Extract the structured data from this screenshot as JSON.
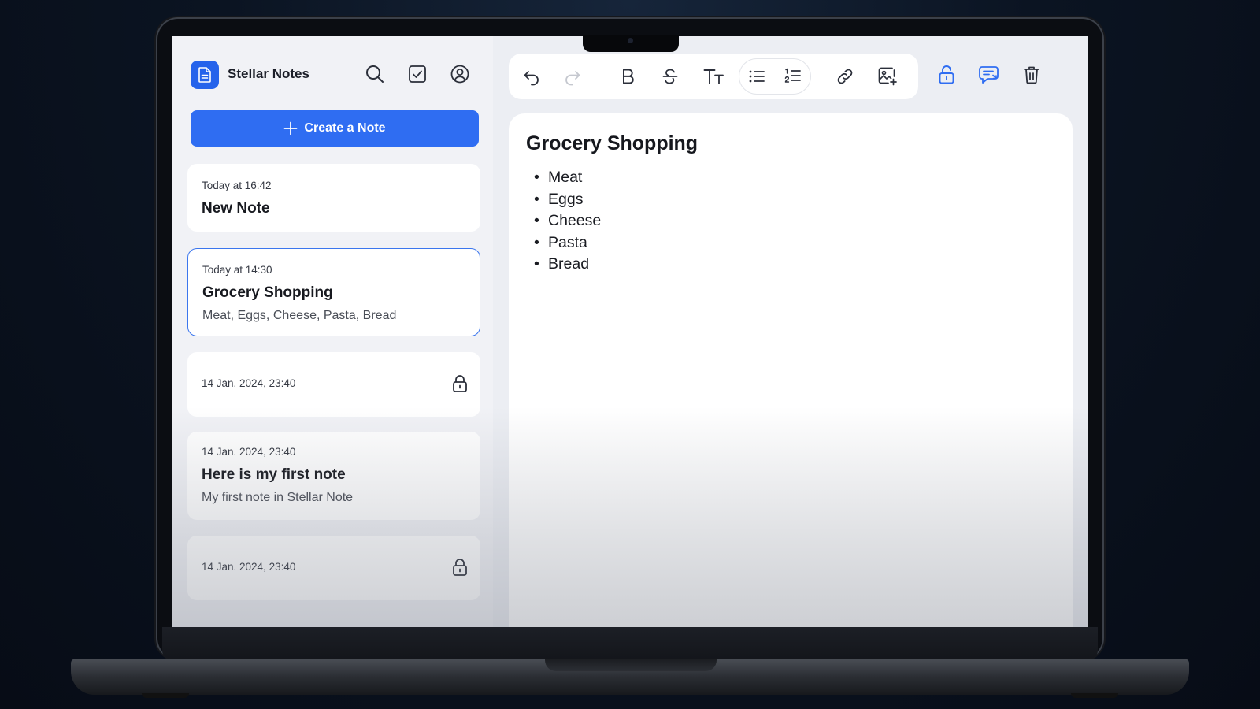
{
  "app": {
    "title": "Stellar Notes"
  },
  "sidebar": {
    "create_label": "Create a Note",
    "icons": [
      "search-icon",
      "checkbox-icon",
      "profile-icon"
    ],
    "notes": [
      {
        "date": "Today at 16:42",
        "title": "New Note",
        "preview": "",
        "locked": false
      },
      {
        "date": "Today at 14:30",
        "title": "Grocery Shopping",
        "preview": "Meat, Eggs, Cheese, Pasta, Bread",
        "locked": false,
        "selected": true
      },
      {
        "date": "14 Jan. 2024, 23:40",
        "title": "",
        "preview": "",
        "locked": true
      },
      {
        "date": "14 Jan. 2024, 23:40",
        "title": "Here is my first note",
        "preview": "My first note in Stellar Note",
        "locked": false
      },
      {
        "date": "14 Jan. 2024, 23:40",
        "title": "",
        "preview": "",
        "locked": true
      }
    ]
  },
  "toolbar": {
    "icons": [
      "undo-icon",
      "redo-icon",
      "bold-icon",
      "strikethrough-icon",
      "text-size-icon",
      "bullet-list-icon",
      "numbered-list-icon",
      "link-icon",
      "add-image-icon"
    ],
    "right_icons": [
      "unlock-icon",
      "share-comment-icon",
      "trash-icon"
    ]
  },
  "editor": {
    "title": "Grocery Shopping",
    "items": [
      "Meat",
      "Eggs",
      "Cheese",
      "Pasta",
      "Bread"
    ]
  },
  "colors": {
    "accent": "#2f6df2",
    "selected_border": "#3b76ee"
  }
}
